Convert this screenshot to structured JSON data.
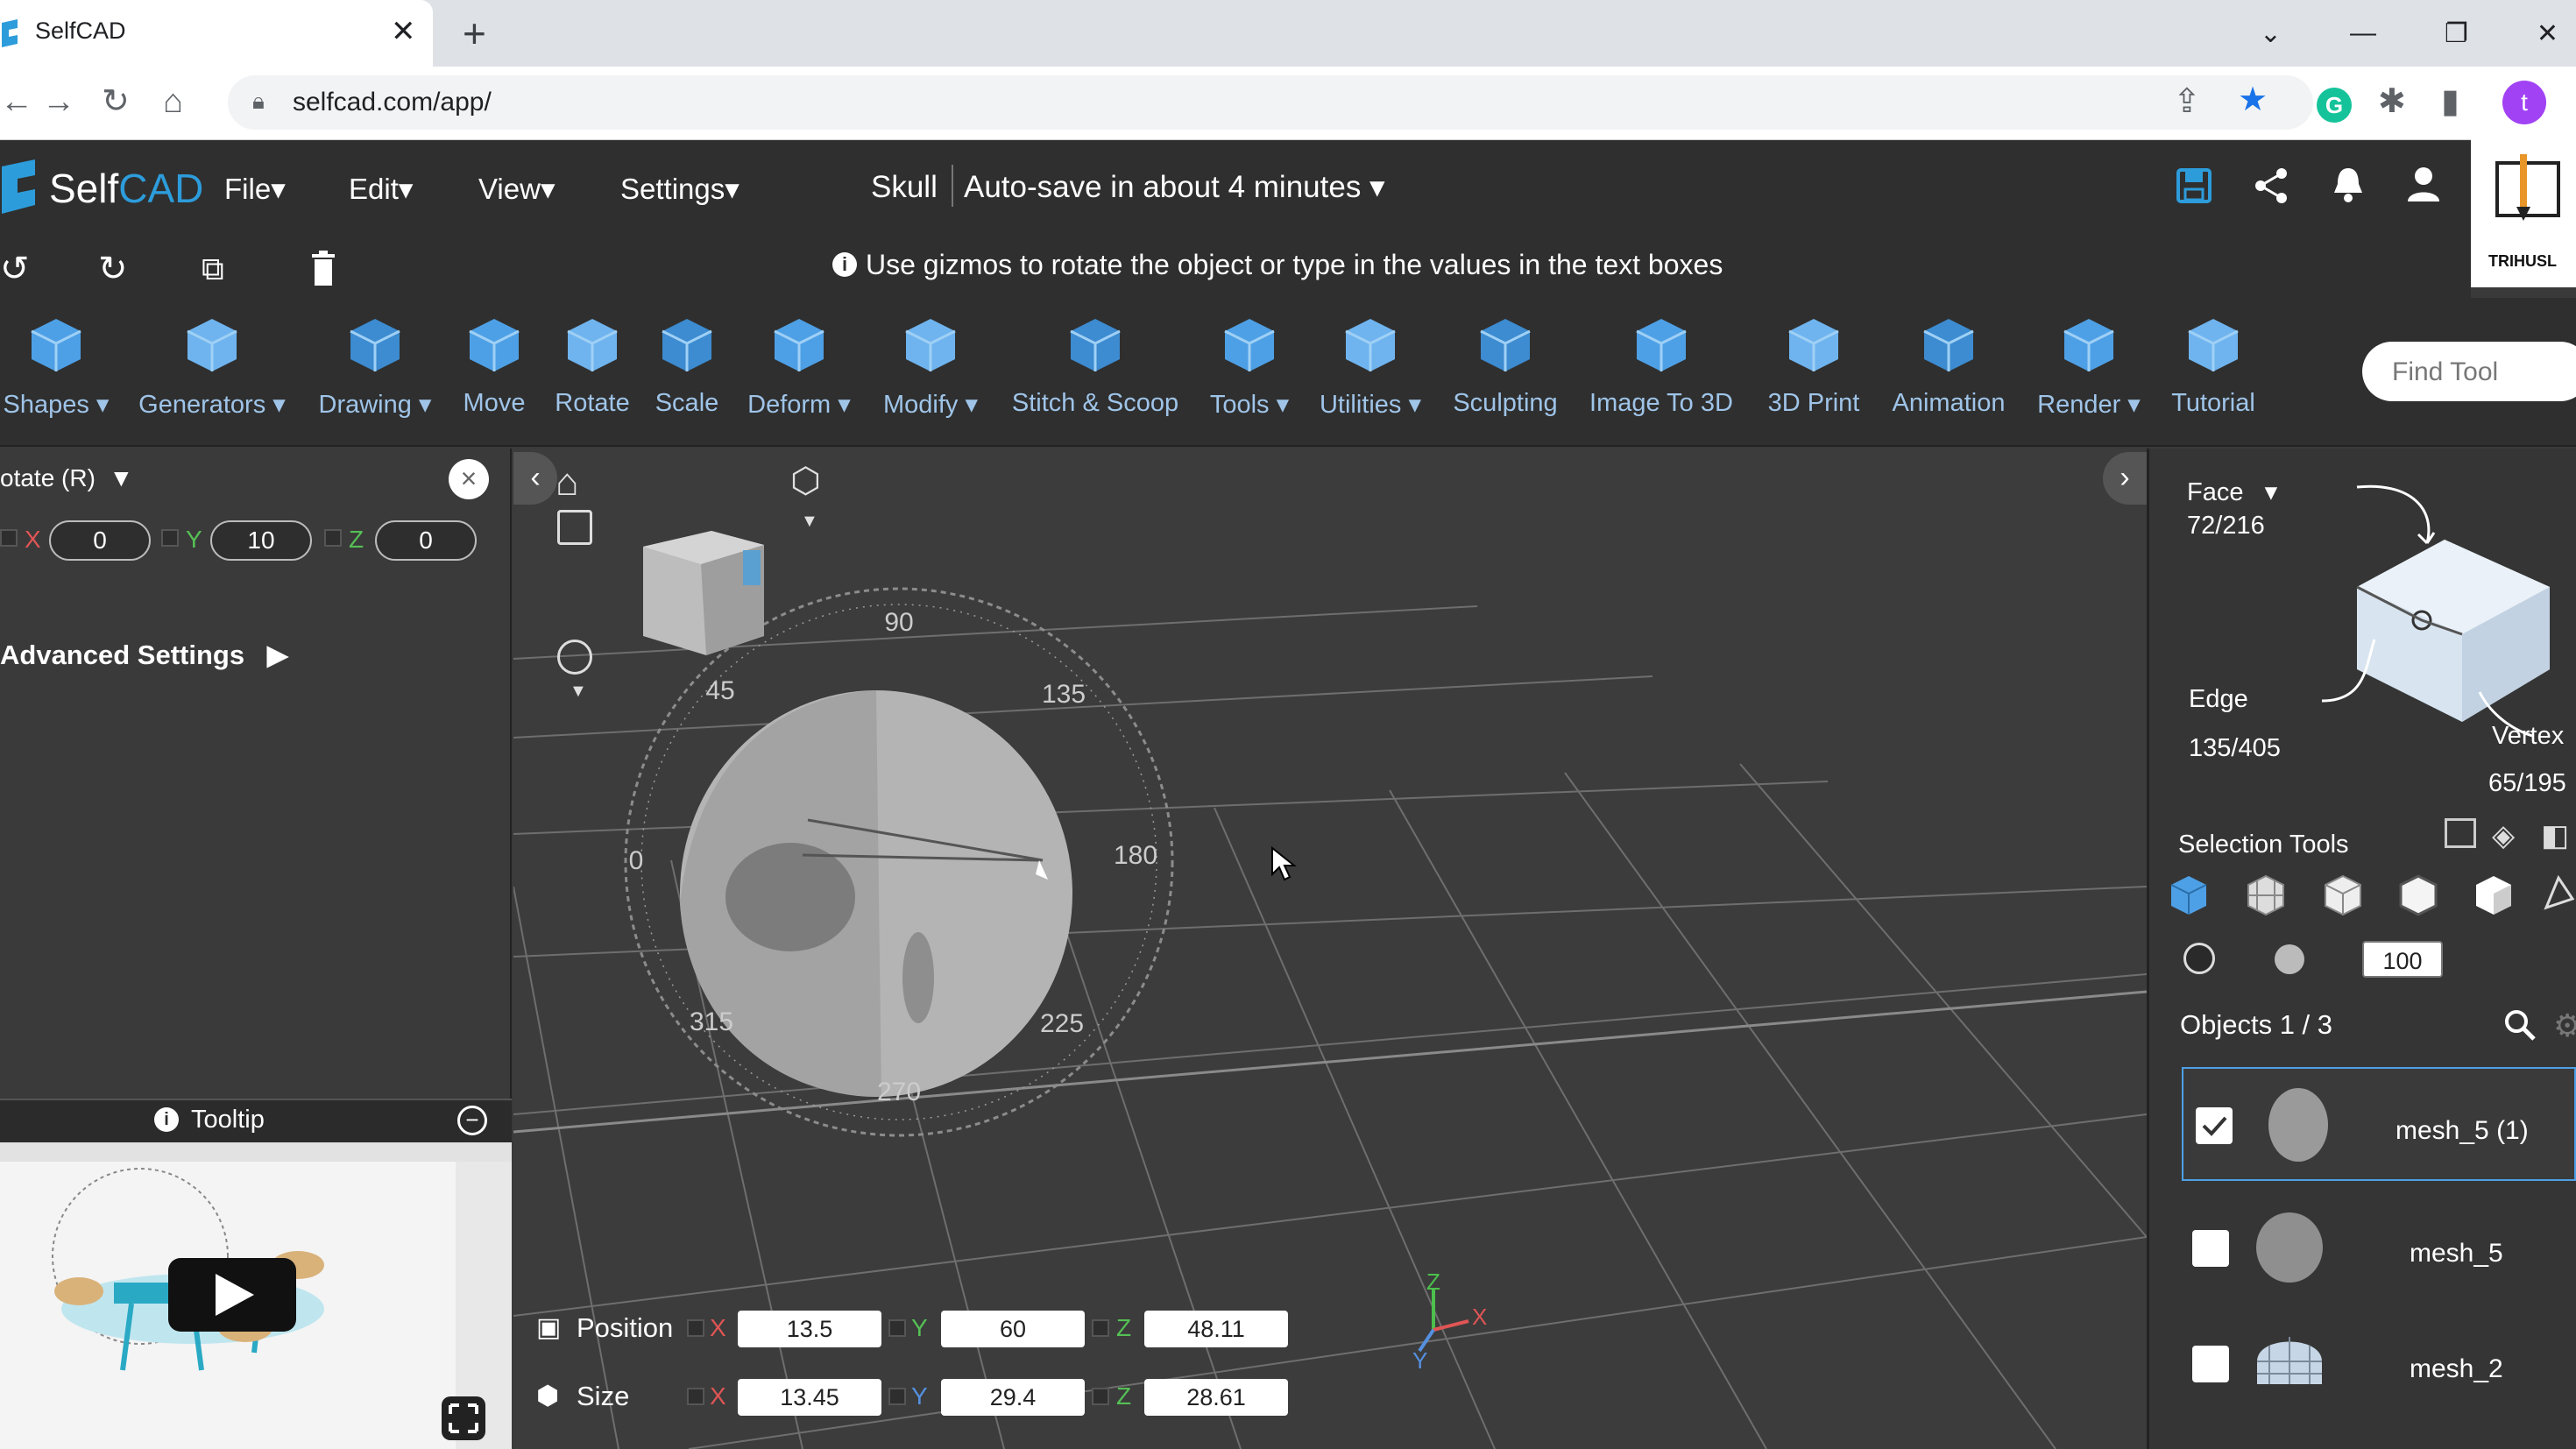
{
  "browser": {
    "tab_title": "SelfCAD",
    "tab_close": "✕",
    "new_tab": "+",
    "url": "selfcad.com/app/",
    "profile_initial": "t"
  },
  "header": {
    "logo_self": "Self",
    "logo_cad": "CAD",
    "menus": [
      "File",
      "Edit",
      "View",
      "Settings"
    ],
    "project_name": "Skull",
    "autosave": "Auto-save in about 4 minutes",
    "brand": "TRIHUSL"
  },
  "info_bar": {
    "message": "Use gizmos to rotate the object or type in the values in the text boxes"
  },
  "toolbar": {
    "tools": [
      {
        "label": "Shapes",
        "dropdown": true,
        "icon": "cube-icon"
      },
      {
        "label": "Generators",
        "dropdown": true,
        "icon": "generator-icon"
      },
      {
        "label": "Drawing",
        "dropdown": true,
        "icon": "drawing-icon"
      },
      {
        "label": "Move",
        "dropdown": false,
        "icon": "move-icon"
      },
      {
        "label": "Rotate",
        "dropdown": false,
        "icon": "rotate-icon"
      },
      {
        "label": "Scale",
        "dropdown": false,
        "icon": "scale-icon"
      },
      {
        "label": "Deform",
        "dropdown": true,
        "icon": "deform-icon"
      },
      {
        "label": "Modify",
        "dropdown": true,
        "icon": "modify-icon"
      },
      {
        "label": "Stitch & Scoop",
        "dropdown": false,
        "icon": "stitch-icon"
      },
      {
        "label": "Tools",
        "dropdown": true,
        "icon": "tools-icon"
      },
      {
        "label": "Utilities",
        "dropdown": true,
        "icon": "utilities-icon"
      },
      {
        "label": "Sculpting",
        "dropdown": false,
        "icon": "sculpting-icon"
      },
      {
        "label": "Image To 3D",
        "dropdown": false,
        "icon": "image-to-3d-icon"
      },
      {
        "label": "3D Print",
        "dropdown": false,
        "icon": "print-icon"
      },
      {
        "label": "Animation",
        "dropdown": false,
        "icon": "animation-icon"
      },
      {
        "label": "Render",
        "dropdown": true,
        "icon": "render-icon"
      },
      {
        "label": "Tutorial",
        "dropdown": false,
        "icon": "tutorial-icon"
      }
    ],
    "find_tool_placeholder": "Find Tool"
  },
  "rotate_panel": {
    "title": "otate (R)",
    "x_label": "X",
    "x_value": "0",
    "y_label": "Y",
    "y_value": "10",
    "z_label": "Z",
    "z_value": "0",
    "advanced_settings": "Advanced Settings",
    "tooltip_label": "Tooltip"
  },
  "viewport": {
    "gizmo_labels": [
      "90",
      "45",
      "135",
      "0",
      "180",
      "315",
      "225",
      "270"
    ],
    "axis_labels": [
      "Z",
      "X",
      "Y"
    ]
  },
  "transform": {
    "position_label": "Position",
    "size_label": "Size",
    "position": {
      "x": "13.5",
      "y": "60",
      "z": "48.11"
    },
    "size": {
      "x": "13.45",
      "y": "29.4",
      "z": "28.61"
    },
    "x": "X",
    "y": "Y",
    "z": "Z"
  },
  "right_panel": {
    "face_label": "Face",
    "face_count": "72/216",
    "edge_label": "Edge",
    "edge_count": "135/405",
    "vertex_label": "Vertex",
    "vertex_count": "65/195",
    "selection_tools": "Selection Tools",
    "brush_size": "100",
    "objects_label": "Objects 1 / 3",
    "objects": [
      {
        "name": "mesh_5 (1)",
        "checked": true
      },
      {
        "name": "mesh_5",
        "checked": false
      },
      {
        "name": "mesh_2",
        "checked": false
      }
    ]
  },
  "colors": {
    "accent": "#4ea0e6",
    "tool_label": "#9fc4e8",
    "panel_bg": "#3a3a3a",
    "header_bg": "#2f2f2f"
  }
}
